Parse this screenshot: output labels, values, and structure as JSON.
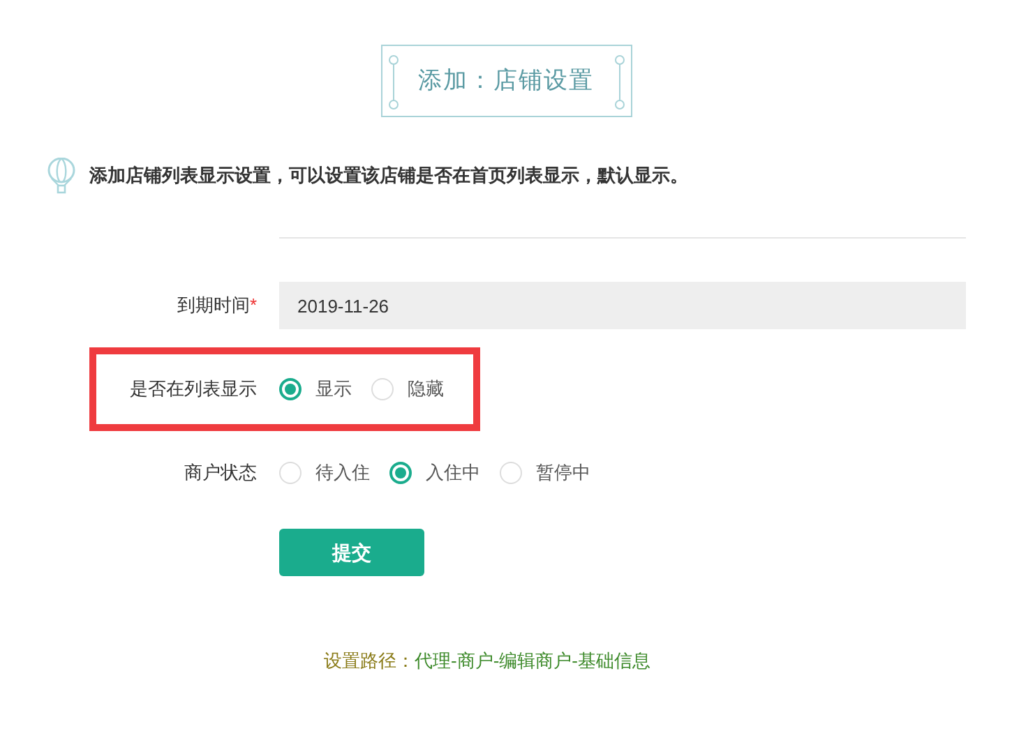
{
  "header": {
    "title": "添加：店铺设置"
  },
  "tip": {
    "text": "添加店铺列表显示设置，可以设置该店铺是否在首页列表显示，默认显示。"
  },
  "form": {
    "fields": [
      {
        "kind": "input",
        "label": "到期时间",
        "required_mark": "*",
        "value": "2019-11-26",
        "highlighted": false
      },
      {
        "kind": "radio",
        "label": "是否在列表显示",
        "highlighted": true,
        "options": [
          {
            "label": "显示",
            "selected": true
          },
          {
            "label": "隐藏",
            "selected": false
          }
        ]
      },
      {
        "kind": "radio",
        "label": "商户状态",
        "highlighted": false,
        "options": [
          {
            "label": "待入住",
            "selected": false
          },
          {
            "label": "入住中",
            "selected": true
          },
          {
            "label": "暂停中",
            "selected": false
          }
        ]
      }
    ],
    "submit": "提交"
  },
  "footer": {
    "label": "设置路径：",
    "path": "代理-商户-编辑商户-基础信息"
  }
}
